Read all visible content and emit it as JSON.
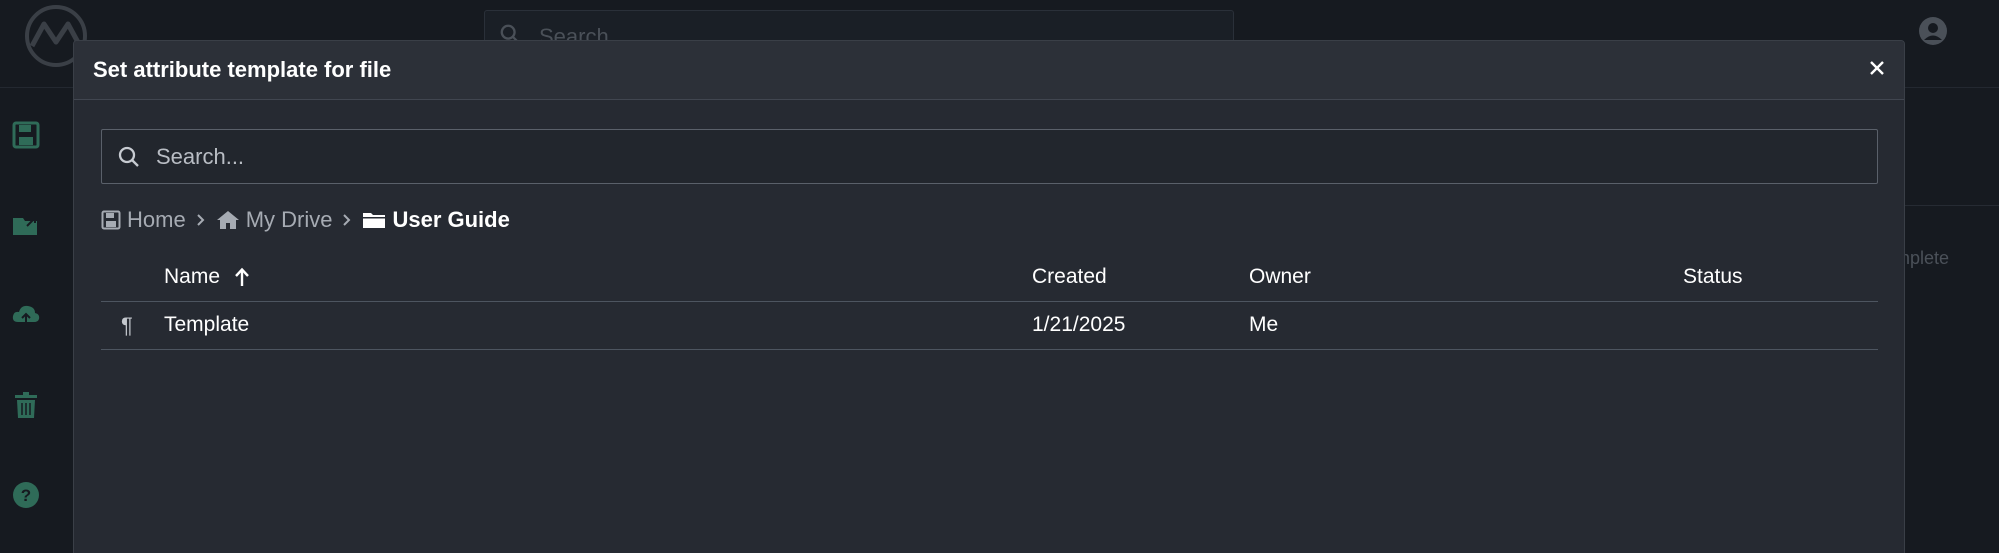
{
  "app": {
    "search_placeholder": "Search...",
    "background_status_text": "mplete"
  },
  "modal": {
    "title": "Set attribute template for file",
    "search_placeholder": "Search...",
    "breadcrumb": [
      {
        "label": "Home",
        "icon": "floppy-icon"
      },
      {
        "label": "My Drive",
        "icon": "home-icon"
      },
      {
        "label": "User Guide",
        "icon": "folder-icon"
      }
    ],
    "table": {
      "columns": {
        "name": "Name",
        "created": "Created",
        "owner": "Owner",
        "status": "Status"
      },
      "sort": {
        "column": "name",
        "direction": "ascending"
      },
      "rows": [
        {
          "icon": "pilcrow-icon",
          "glyph": "¶",
          "name": "Template",
          "created": "1/21/2025",
          "owner": "Me",
          "status": ""
        }
      ]
    }
  },
  "colors": {
    "accent": "#2f6b58",
    "modal_bg": "#262a32",
    "header_bg": "#2c3038",
    "page_bg": "#161a20"
  }
}
